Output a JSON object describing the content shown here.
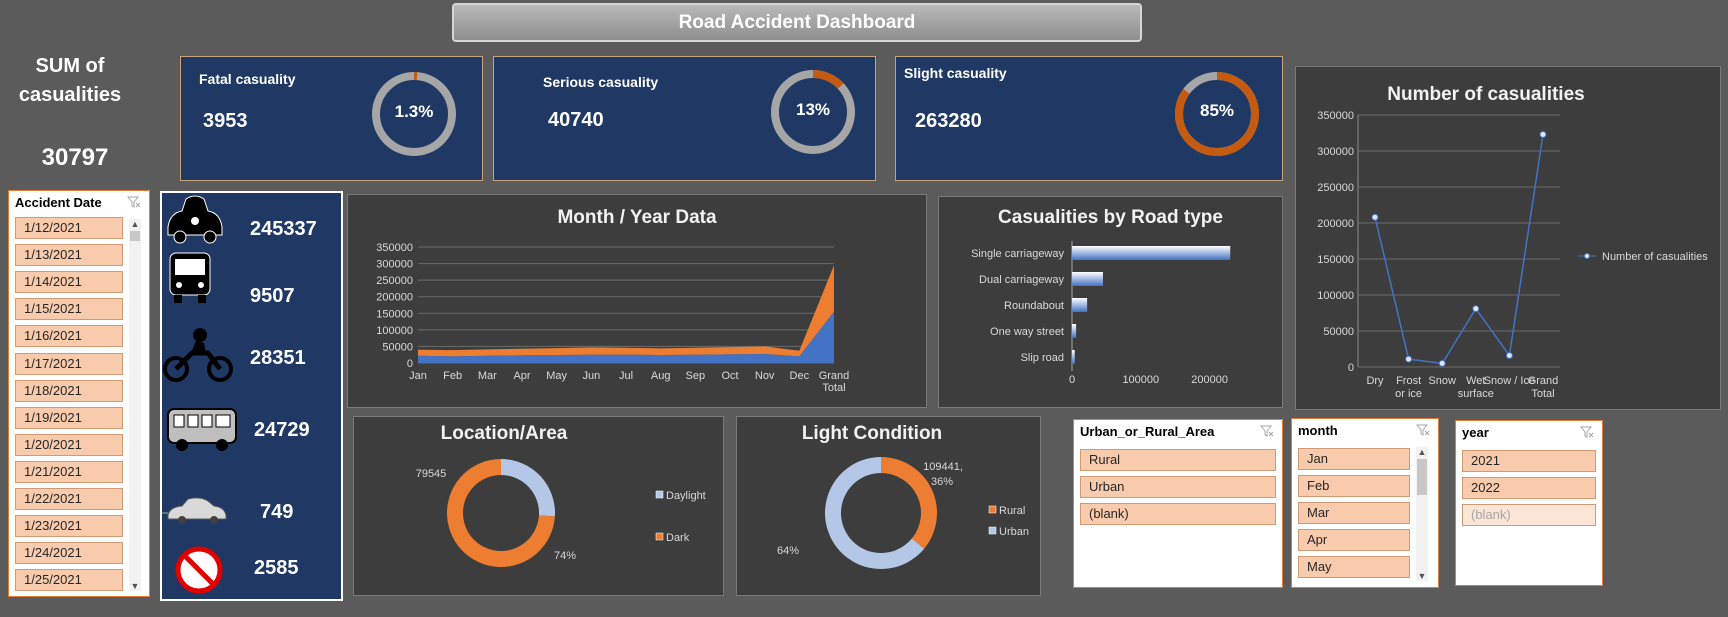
{
  "header": {
    "title": "Road Accident Dashboard"
  },
  "summary": {
    "label_line1": "SUM  of",
    "label_line2": "casualities",
    "value": "30797"
  },
  "kpis": [
    {
      "label": "Fatal casuality",
      "value": "3953",
      "percent": "1.3%",
      "fraction": 0.013
    },
    {
      "label": "Serious casuality",
      "value": "40740",
      "percent": "13%",
      "fraction": 0.13
    },
    {
      "label": "Slight casuality",
      "value": "263280",
      "percent": "85%",
      "fraction": 0.85
    }
  ],
  "vehicles": [
    {
      "icon": "car-icon",
      "value": "245337"
    },
    {
      "icon": "bus-icon",
      "value": "9507"
    },
    {
      "icon": "motorcycle-icon",
      "value": "28351"
    },
    {
      "icon": "van-icon",
      "value": "24729"
    },
    {
      "icon": "taxi-icon",
      "value": "749"
    },
    {
      "icon": "no-entry-icon",
      "value": "2585"
    }
  ],
  "date_slicer": {
    "title": "Accident Date",
    "items": [
      "1/12/2021",
      "1/13/2021",
      "1/14/2021",
      "1/15/2021",
      "1/16/2021",
      "1/17/2021",
      "1/18/2021",
      "1/19/2021",
      "1/20/2021",
      "1/21/2021",
      "1/22/2021",
      "1/23/2021",
      "1/24/2021",
      "1/25/2021"
    ]
  },
  "area_slicer": {
    "title": "Urban_or_Rural_Area",
    "items": [
      "Rural",
      "Urban",
      "(blank)"
    ]
  },
  "month_slicer": {
    "title": "month",
    "items": [
      "Jan",
      "Feb",
      "Mar",
      "Apr",
      "May"
    ]
  },
  "year_slicer": {
    "title": "year",
    "items": [
      "2021",
      "2022",
      "(blank)"
    ]
  },
  "chart_data": [
    {
      "type": "area",
      "title": "Month  / Year Data",
      "categories": [
        "Jan",
        "Feb",
        "Mar",
        "Apr",
        "May",
        "Jun",
        "Jul",
        "Aug",
        "Sep",
        "Oct",
        "Nov",
        "Dec",
        "Grand Total"
      ],
      "y_ticks": [
        "0",
        "50000",
        "100000",
        "150000",
        "200000",
        "250000",
        "300000",
        "350000"
      ],
      "ylim": [
        0,
        350000
      ],
      "series": [
        {
          "values": [
            22000,
            20000,
            22000,
            23000,
            24000,
            25000,
            25000,
            24000,
            25000,
            26000,
            27000,
            20000,
            155000
          ],
          "color": "#4472c4"
        },
        {
          "values": [
            18000,
            19000,
            19000,
            20000,
            21000,
            22000,
            21000,
            20000,
            21000,
            22000,
            23000,
            17000,
            140000
          ],
          "color": "#ed7d31"
        }
      ]
    },
    {
      "type": "bar",
      "title": "Casualities by Road type",
      "categories": [
        "Single carriageway",
        "Dual carriageway",
        "Roundabout",
        "One way street",
        "Slip road"
      ],
      "values": [
        230000,
        45000,
        22000,
        6000,
        4000
      ],
      "x_ticks": [
        "0",
        "100000",
        "200000"
      ],
      "xlim": [
        0,
        250000
      ]
    },
    {
      "type": "line",
      "title": "Number of casualities",
      "categories": [
        "Dry",
        "Frost or ice",
        "Snow",
        "Wet surface",
        "Snow / Ice",
        "Grand Total"
      ],
      "category_lines": [
        [
          "Dry"
        ],
        [
          "Frost",
          "or ice"
        ],
        [
          "Snow"
        ],
        [
          "Wet",
          "surface"
        ],
        [
          "Snow / Ice"
        ],
        [
          "Grand",
          "Total"
        ]
      ],
      "values": [
        208000,
        11000,
        5000,
        81000,
        16000,
        323000
      ],
      "y_ticks": [
        "0",
        "50000",
        "100000",
        "150000",
        "200000",
        "250000",
        "300000",
        "350000"
      ],
      "ylim": [
        0,
        350000
      ],
      "legend": "Number of casualities"
    },
    {
      "type": "pie",
      "title": "Location/Area",
      "labels": [
        "Daylight",
        "Dark"
      ],
      "data_labels": [
        "79545",
        "74%"
      ],
      "values": [
        26,
        74
      ]
    },
    {
      "type": "pie",
      "title": "Light Condition",
      "labels": [
        "Rural",
        "Urban"
      ],
      "data_labels": [
        "109441,",
        "36%",
        "64%"
      ],
      "values": [
        36,
        64
      ]
    }
  ]
}
